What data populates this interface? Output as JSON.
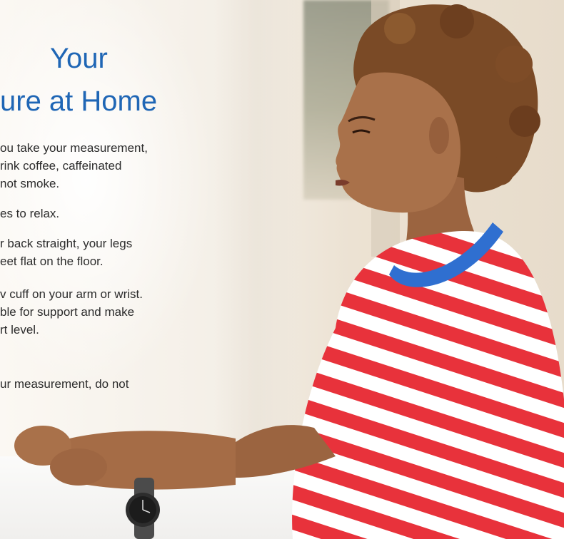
{
  "title": {
    "line1": "Your",
    "line2": "ure at Home"
  },
  "steps": {
    "l1": "ou take your measurement,",
    "l2": "rink coffee, caffeinated",
    "l3": "not smoke.",
    "l4": "es to relax.",
    "l5": "r back straight, your legs",
    "l6": "eet flat on the floor.",
    "l7": "v cuff on your arm or wrist.",
    "l8": "ble for support and make",
    "l9": "rt level.",
    "l10": "ur measurement, do not"
  },
  "colors": {
    "title": "#1f66b5",
    "body_text": "#2c2c2c",
    "shirt_red": "#e8323b",
    "shirt_white": "#ffffff",
    "collar": "#2f6fd0"
  },
  "icons": [
    "woman-photo",
    "wristwatch-icon"
  ]
}
